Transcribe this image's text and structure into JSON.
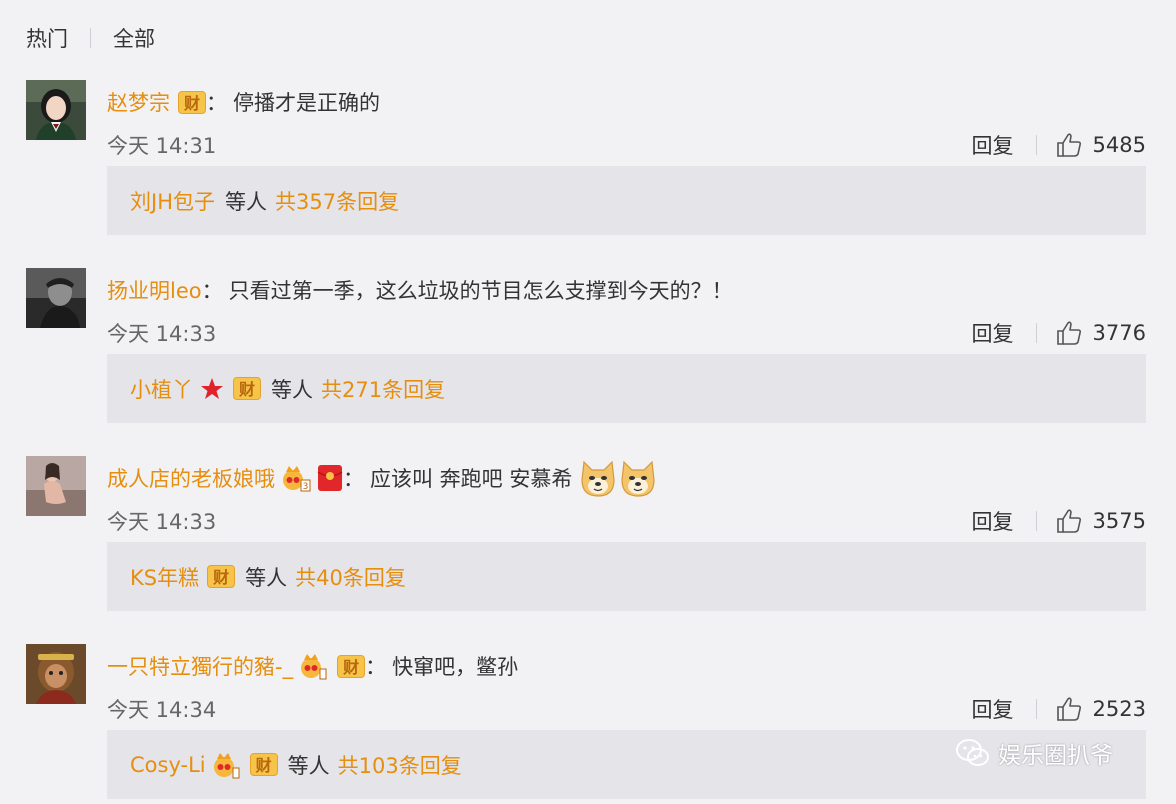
{
  "tabs": {
    "hot": "热门",
    "all": "全部"
  },
  "comments": [
    {
      "user": "赵梦宗",
      "badges": [
        "财"
      ],
      "text": "停播才是正确的",
      "time": "今天 14:31",
      "reply_label": "回复",
      "likes": "5485",
      "replies": {
        "user": "刘JH包子",
        "badges": [],
        "deng": "等人",
        "total": "共357条回复"
      }
    },
    {
      "user": "扬业明leo",
      "badges": [],
      "text": "只看过第一季，这么垃圾的节目怎么支撑到今天的？！",
      "time": "今天 14:33",
      "reply_label": "回复",
      "likes": "3776",
      "replies": {
        "user": "小植丫",
        "badges": [
          "star",
          "财"
        ],
        "deng": "等人",
        "total": "共271条回复"
      }
    },
    {
      "user": "成人店的老板娘哦",
      "badges": [
        "crown-3",
        "red-envelope"
      ],
      "text": "应该叫  奔跑吧  安慕希",
      "emoji": [
        "doge-emoji",
        "doge-emoji"
      ],
      "time": "今天 14:33",
      "reply_label": "回复",
      "likes": "3575",
      "replies": {
        "user": "KS年糕",
        "badges": [
          "财"
        ],
        "deng": "等人",
        "total": "共40条回复"
      }
    },
    {
      "user": "一只特立獨行的豬-_",
      "badges": [
        "crown",
        "财"
      ],
      "text": "快窜吧，鳖孙",
      "time": "今天 14:34",
      "reply_label": "回复",
      "likes": "2523",
      "replies": {
        "user": "Cosy-Li",
        "badges": [
          "crown",
          "财"
        ],
        "deng": "等人",
        "total": "共103条回复"
      }
    }
  ],
  "watermark": "娱乐圈扒爷",
  "colors": {
    "username": "#e68e0e",
    "background": "#f2f2f5",
    "reply_box": "#e4e4e9"
  }
}
